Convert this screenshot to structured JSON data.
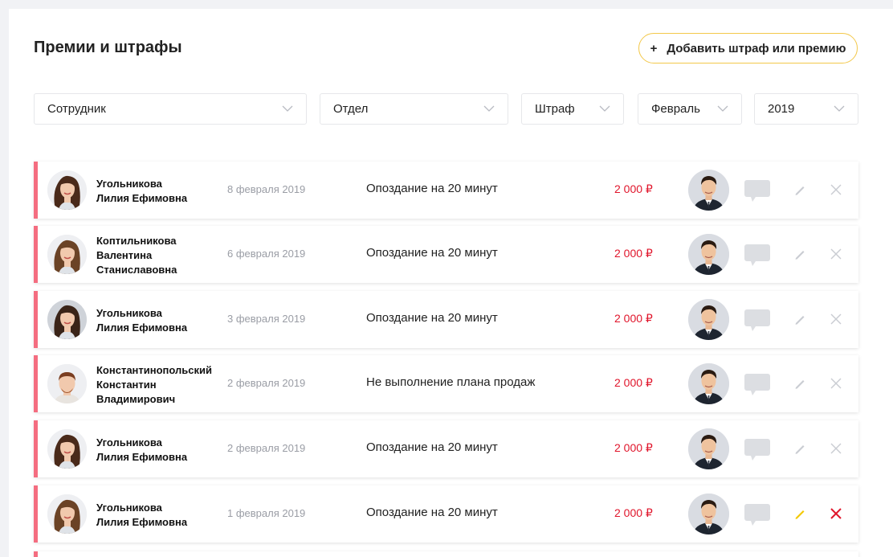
{
  "page": {
    "title": "Премии и штрафы"
  },
  "add_button": {
    "label": "Добавить штраф или премию",
    "icon": "plus-icon"
  },
  "filters": {
    "employee": "Сотрудник",
    "department": "Отдел",
    "type": "Штраф",
    "month": "Февраль",
    "year": "2019"
  },
  "colors": {
    "accent_border": "#f46d80",
    "amount": "#e0152b",
    "button_border": "#f3c84a",
    "edit_active": "#f3c800",
    "delete_active": "#e0152b"
  },
  "records": [
    {
      "name1": "Угольникова",
      "name2": "Лилия Ефимовна",
      "name3": "",
      "date": "8 февраля 2019",
      "reason": "Опоздание на 20 минут",
      "amount": "2 000 ₽",
      "avatar": "woman-1",
      "active": false
    },
    {
      "name1": "Коптильникова",
      "name2": "Валентина",
      "name3": "Станиславовна",
      "date": "6 февраля 2019",
      "reason": "Опоздание на 20 минут",
      "amount": "2 000 ₽",
      "avatar": "woman-2",
      "active": false
    },
    {
      "name1": "Угольникова",
      "name2": "Лилия Ефимовна",
      "name3": "",
      "date": "3 февраля 2019",
      "reason": "Опоздание на 20 минут",
      "amount": "2 000 ₽",
      "avatar": "woman-3",
      "active": false
    },
    {
      "name1": "Константинопольский",
      "name2": "Константин",
      "name3": "Владимирович",
      "date": "2 февраля 2019",
      "reason": "Не выполнение плана продаж",
      "amount": "2 000 ₽",
      "avatar": "man-1",
      "active": false
    },
    {
      "name1": "Угольникова",
      "name2": "Лилия Ефимовна",
      "name3": "",
      "date": "2 февраля 2019",
      "reason": "Опоздание на 20 минут",
      "amount": "2 000 ₽",
      "avatar": "woman-1",
      "active": false
    },
    {
      "name1": "Угольникова",
      "name2": "Лилия Ефимовна",
      "name3": "",
      "date": "1 февраля 2019",
      "reason": "Опоздание на 20 минут",
      "amount": "2 000 ₽",
      "avatar": "woman-2",
      "active": true
    }
  ]
}
